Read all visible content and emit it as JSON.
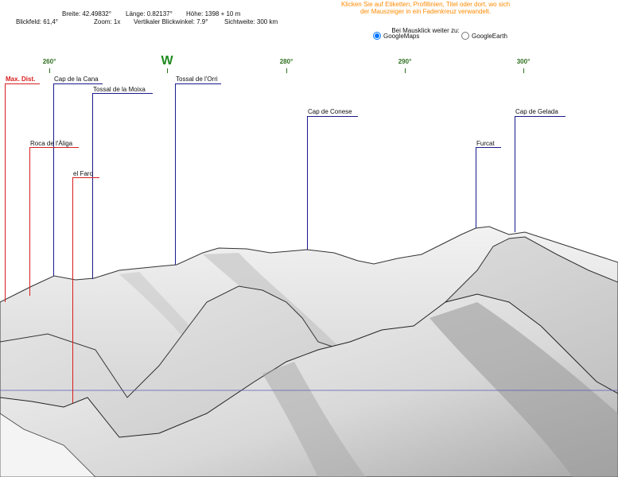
{
  "info": {
    "breite": "Breite: 42.49832°",
    "laenge": "Länge: 0.82137°",
    "hoehe": "Höhe: 1398 + 10 m",
    "blickfeld": "Blickfeld: 61,4°",
    "zoom": "Zoom: 1x",
    "vertikal": "Vertikaler Blickwinkel: 7.9°",
    "sichtweite": "Sichtweite: 300 km"
  },
  "hint": {
    "line1": "Klicken Sie auf Etiketten, Profillinien, Titel oder dort, wo sich",
    "line2": "der Mauszeiger in ein Fadenkreuz verwandelt."
  },
  "mausklick": "Bei Mausklick weiter zu:",
  "options": {
    "googlemaps": "GoogleMaps",
    "googleearth": "GoogleEarth",
    "selected": "GoogleMaps"
  },
  "compass": {
    "d260": "260°",
    "w": "W",
    "d280": "280°",
    "d290": "290°",
    "d300": "300°"
  },
  "labels": {
    "maxdist": "Max. Dist.",
    "capcana": "Cap de la Cana",
    "moixa": "Tossal de la Moixa",
    "orri": "Tossal de l'Orri",
    "conese": "Cap de Conese",
    "gelada": "Cap de Gelada",
    "aliga": "Roca de l'Àliga",
    "faro": "el Faro",
    "furcat": "Furcat"
  },
  "colors": {
    "red_label": "#d81e1e",
    "blue_label": "#1a1a8c",
    "hint": "#ff8a00",
    "compass": "#2f6f1f"
  }
}
